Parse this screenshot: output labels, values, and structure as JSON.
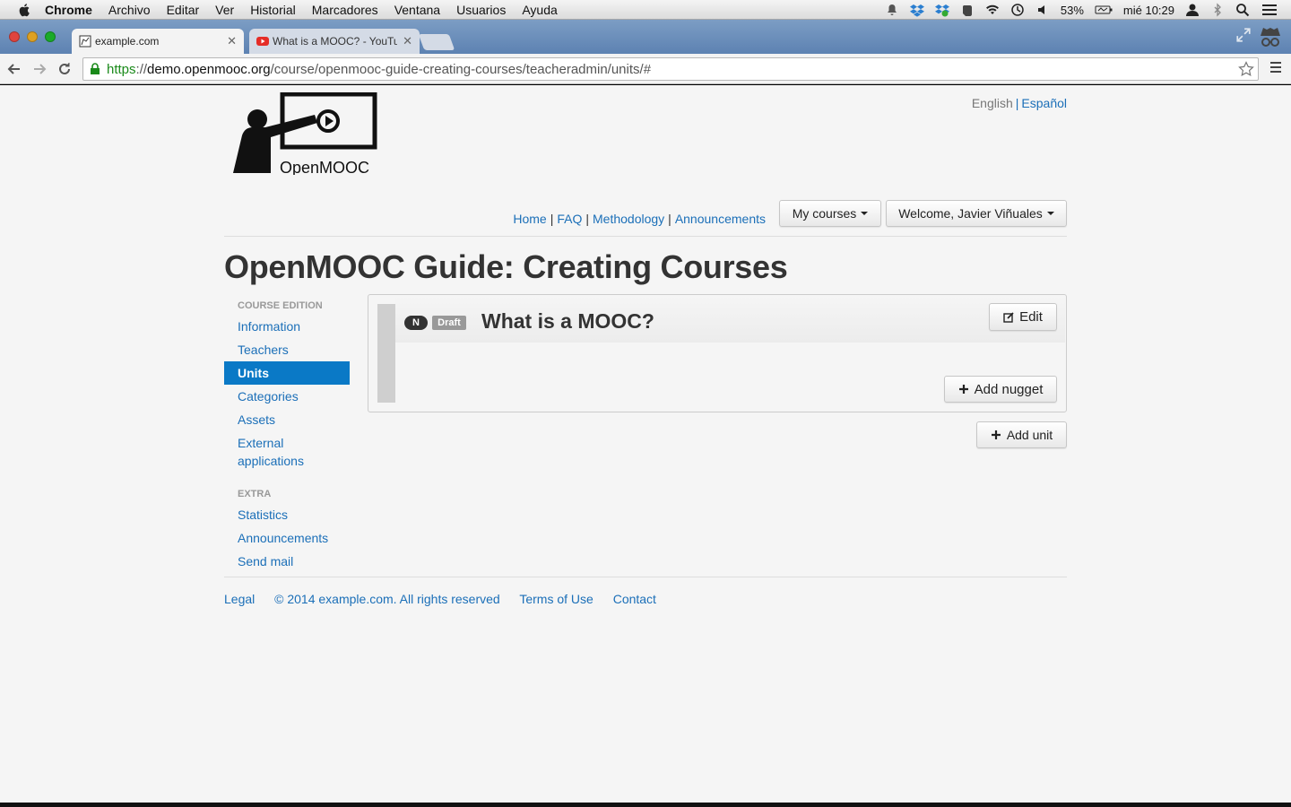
{
  "menubar": {
    "app": "Chrome",
    "items": [
      "Archivo",
      "Editar",
      "Ver",
      "Historial",
      "Marcadores",
      "Ventana",
      "Usuarios",
      "Ayuda"
    ],
    "battery": "53%",
    "clock": "mié 10:29"
  },
  "browser": {
    "tabs": [
      {
        "title": "example.com",
        "active": true
      },
      {
        "title": "What is a MOOC? - YouTub",
        "active": false
      }
    ],
    "url": {
      "scheme": "https",
      "sep": "://",
      "host": "demo.openmooc.org",
      "path": "/course/openmooc-guide-creating-courses/teacheradmin/units/#"
    }
  },
  "header": {
    "logo_text": "OpenMOOC",
    "lang_current": "English",
    "lang_sep": "|",
    "lang_other": "Español",
    "nav": [
      "Home",
      "FAQ",
      "Methodology",
      "Announcements"
    ],
    "nav_sep": "|",
    "my_courses": "My courses",
    "welcome": "Welcome, Javier Viñuales"
  },
  "page": {
    "title": "OpenMOOC Guide: Creating Courses"
  },
  "sidebar": {
    "section1": "COURSE EDITION",
    "items1": [
      "Information",
      "Teachers",
      "Units",
      "Categories",
      "Assets",
      "External applications"
    ],
    "active": "Units",
    "section2": "EXTRA",
    "items2": [
      "Statistics",
      "Announcements",
      "Send mail"
    ]
  },
  "unit": {
    "badge_n": "N",
    "badge_status": "Draft",
    "title": "What is a MOOC?",
    "edit_label": "Edit",
    "add_nugget_label": "Add nugget"
  },
  "add_unit_label": "Add unit",
  "footer": {
    "legal": "Legal",
    "copyright": "© 2014 example.com. All rights reserved",
    "terms": "Terms of Use",
    "contact": "Contact"
  },
  "colors": {
    "link": "#1b6fb8",
    "active_nav": "#0a79c6",
    "url_scheme": "#1a8a1a"
  }
}
